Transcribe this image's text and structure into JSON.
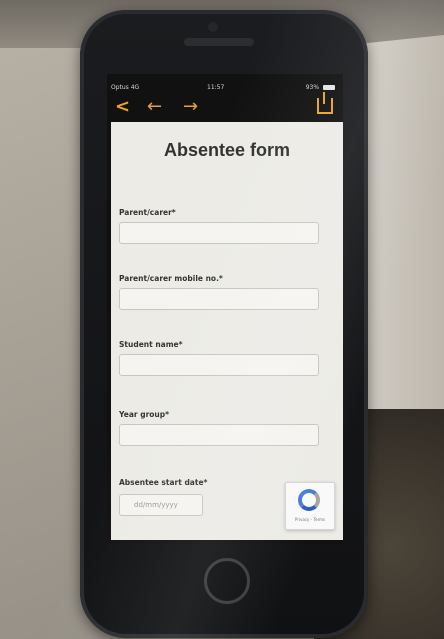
{
  "status_bar": {
    "carrier": "Optus 4G",
    "time": "11:57",
    "battery": "93%"
  },
  "nav": {
    "back": "<",
    "prev": "←",
    "next": "→"
  },
  "form": {
    "title": "Absentee form",
    "fields": [
      {
        "label": "Parent/carer*"
      },
      {
        "label": "Parent/carer mobile no.*"
      },
      {
        "label": "Student name*"
      },
      {
        "label": "Year group*"
      },
      {
        "label": "Absentee start date*",
        "placeholder": "dd/mm/yyyy"
      }
    ]
  },
  "recaptcha": {
    "footer": "Privacy - Terms"
  }
}
